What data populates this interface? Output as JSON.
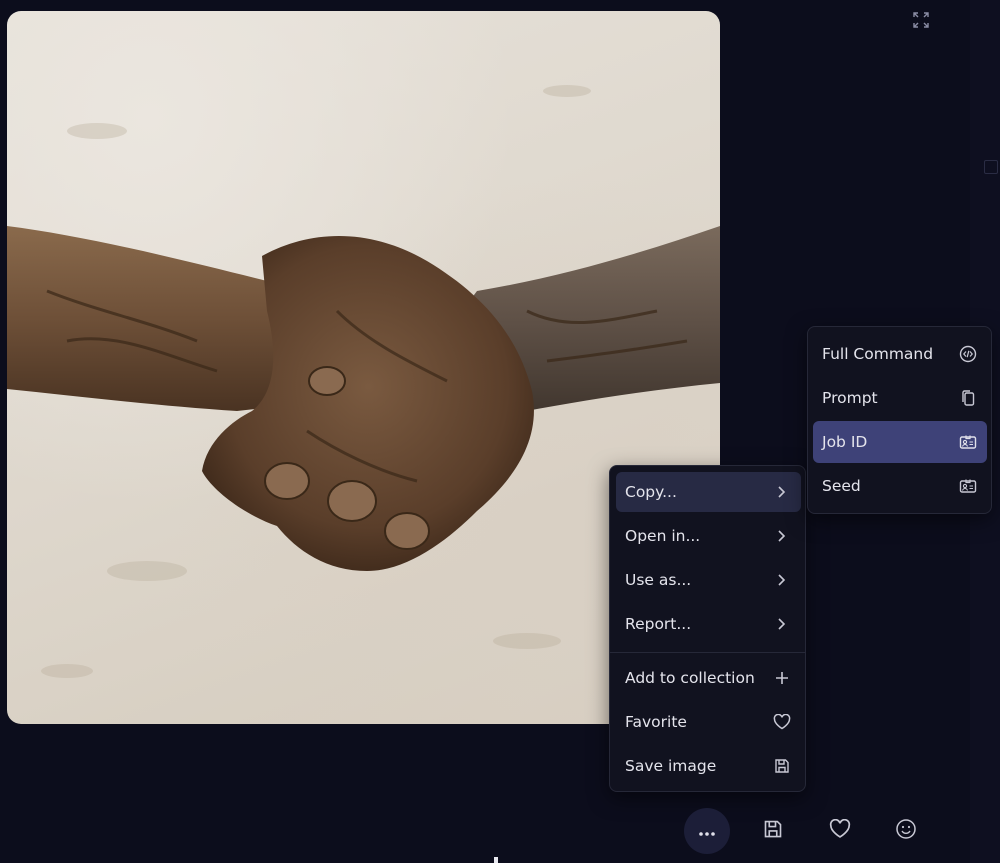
{
  "context_menu": {
    "items": [
      {
        "label": "Copy...",
        "icon": "chevron-right-icon"
      },
      {
        "label": "Open in...",
        "icon": "chevron-right-icon"
      },
      {
        "label": "Use as...",
        "icon": "chevron-right-icon"
      },
      {
        "label": "Report...",
        "icon": "chevron-right-icon"
      },
      {
        "label": "Add to collection",
        "icon": "plus-icon"
      },
      {
        "label": "Favorite",
        "icon": "heart-icon"
      },
      {
        "label": "Save image",
        "icon": "floppy-disk-icon"
      }
    ]
  },
  "copy_submenu": {
    "items": [
      {
        "label": "Full Command",
        "icon": "code-icon"
      },
      {
        "label": "Prompt",
        "icon": "copy-icon"
      },
      {
        "label": "Job ID",
        "icon": "id-card-icon"
      },
      {
        "label": "Seed",
        "icon": "id-card-icon"
      }
    ]
  },
  "toolbar": {
    "buttons": [
      {
        "name": "more-options",
        "icon": "ellipsis-icon"
      },
      {
        "name": "save",
        "icon": "floppy-disk-icon"
      },
      {
        "name": "favorite",
        "icon": "heart-icon"
      },
      {
        "name": "emoji-react",
        "icon": "smiley-icon"
      }
    ]
  },
  "colors": {
    "background": "#0c0d1c",
    "menu_bg": "#11121f",
    "menu_hover": "#272a44",
    "submenu_active": "#3e4278",
    "text": "#e4e4ec"
  }
}
